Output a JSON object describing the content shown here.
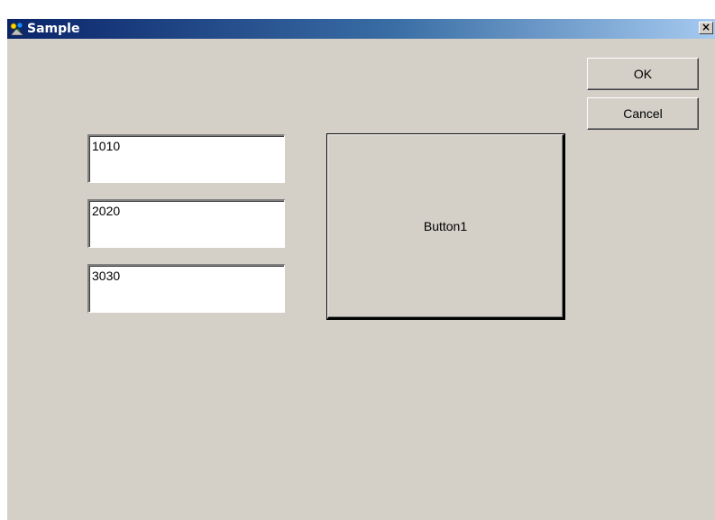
{
  "window": {
    "title": "Sample",
    "close_glyph": "×",
    "icon": "app-icon"
  },
  "buttons": {
    "ok_label": "OK",
    "cancel_label": "Cancel",
    "big_label": "Button1"
  },
  "fields": [
    {
      "value": "1010"
    },
    {
      "value": "2020"
    },
    {
      "value": "3030"
    }
  ],
  "colors": {
    "titlebar_start": "#0a246a",
    "titlebar_end": "#a6caf0",
    "face": "#d4d0c8"
  }
}
